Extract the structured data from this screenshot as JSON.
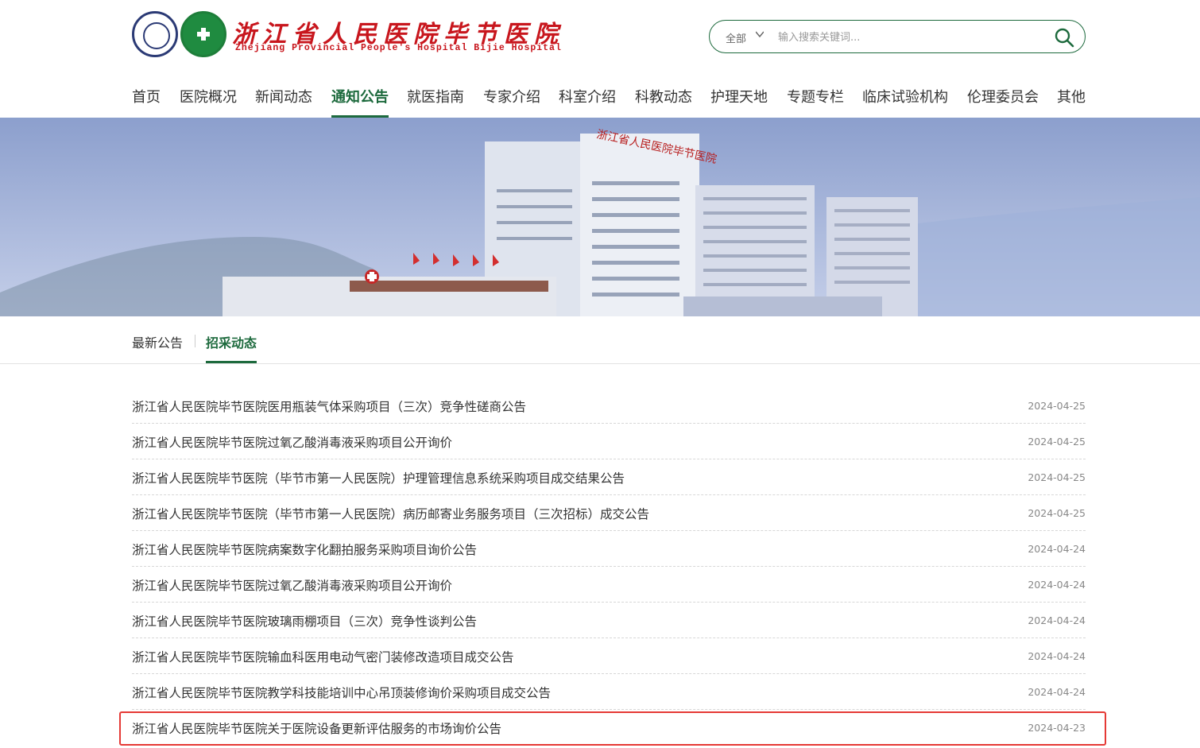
{
  "header": {
    "logo_cn": "浙江省人民医院毕节医院",
    "logo_en": "Zhejiang Provincial People's Hospital Bijie Hospital"
  },
  "search": {
    "scope": "全部",
    "placeholder": "输入搜索关键词..."
  },
  "nav": {
    "items": [
      {
        "label": "首页"
      },
      {
        "label": "医院概况"
      },
      {
        "label": "新闻动态"
      },
      {
        "label": "通知公告"
      },
      {
        "label": "就医指南"
      },
      {
        "label": "专家介绍"
      },
      {
        "label": "科室介绍"
      },
      {
        "label": "科教动态"
      },
      {
        "label": "护理天地"
      },
      {
        "label": "专题专栏"
      },
      {
        "label": "临床试验机构"
      },
      {
        "label": "伦理委员会"
      },
      {
        "label": "其他"
      }
    ],
    "active": "通知公告"
  },
  "banner": {
    "sign_text": "浙江省人民医院毕节医院"
  },
  "subnav": {
    "tabs": [
      {
        "label": "最新公告"
      },
      {
        "label": "招采动态"
      }
    ],
    "active": "招采动态"
  },
  "list": {
    "items": [
      {
        "title": "浙江省人民医院毕节医院医用瓶装气体采购项目（三次）竞争性磋商公告",
        "date": "2024-04-25"
      },
      {
        "title": "浙江省人民医院毕节医院过氧乙酸消毒液采购项目公开询价",
        "date": "2024-04-25"
      },
      {
        "title": "浙江省人民医院毕节医院（毕节市第一人民医院）护理管理信息系统采购项目成交结果公告",
        "date": "2024-04-25"
      },
      {
        "title": "浙江省人民医院毕节医院（毕节市第一人民医院）病历邮寄业务服务项目（三次招标）成交公告",
        "date": "2024-04-25"
      },
      {
        "title": "浙江省人民医院毕节医院病案数字化翻拍服务采购项目询价公告",
        "date": "2024-04-24"
      },
      {
        "title": "浙江省人民医院毕节医院过氧乙酸消毒液采购项目公开询价",
        "date": "2024-04-24"
      },
      {
        "title": "浙江省人民医院毕节医院玻璃雨棚项目（三次）竞争性谈判公告",
        "date": "2024-04-24"
      },
      {
        "title": "浙江省人民医院毕节医院输血科医用电动气密门装修改造项目成交公告",
        "date": "2024-04-24"
      },
      {
        "title": "浙江省人民医院毕节医院教学科技能培训中心吊顶装修询价采购项目成交公告",
        "date": "2024-04-24"
      },
      {
        "title": "浙江省人民医院毕节医院关于医院设备更新评估服务的市场询价公告",
        "date": "2024-04-23"
      }
    ]
  },
  "theme": {
    "primary": "#1d6a3d",
    "logo_red": "#c8161d",
    "highlight_red": "#e53935"
  }
}
